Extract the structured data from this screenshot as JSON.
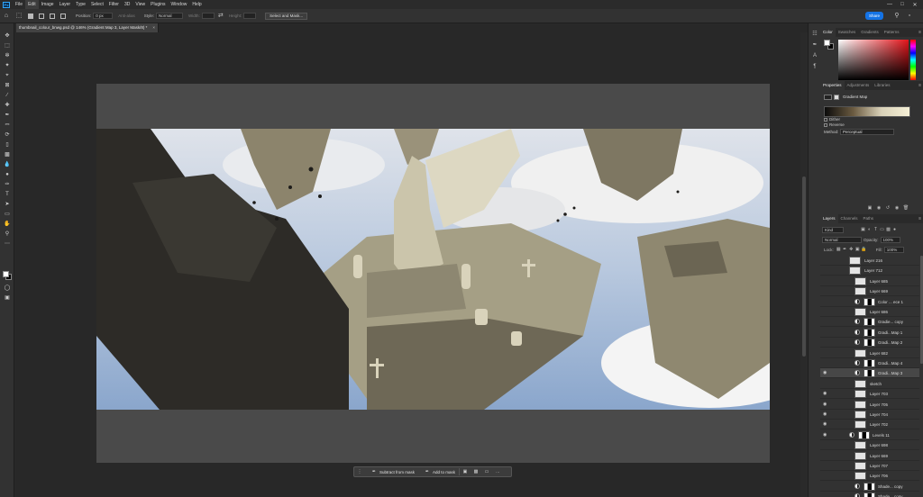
{
  "menu": [
    "File",
    "Edit",
    "Image",
    "Layer",
    "Type",
    "Select",
    "Filter",
    "3D",
    "View",
    "Plugins",
    "Window",
    "Help"
  ],
  "app_logo": "Ps",
  "options": {
    "position_label": "Position:",
    "position_value": "0 px",
    "antialias_label": "Anti-alias",
    "style_label": "Style:",
    "style_value": "Normal",
    "width_label": "Width:",
    "height_label": "Height:",
    "select_mask_button": "Select and Mask...",
    "share_button": "Share"
  },
  "document_tab": {
    "title": "thumbnail_colour_bnwg.psd @ 146% (Gradient Map 3, Layer Mask/8) *",
    "close": "×"
  },
  "contextual_taskbar": {
    "subtract_label": "Subtract from mask",
    "add_label": "Add to mask",
    "more": "···"
  },
  "color_panel": {
    "tabs": [
      "Color",
      "Swatches",
      "Gradients",
      "Patterns"
    ],
    "active_tab": "Color",
    "foreground": "#ffffff",
    "background": "#000000",
    "hue_color": "#e3141a"
  },
  "properties_panel": {
    "tabs": [
      "Properties",
      "Adjustments",
      "Libraries"
    ],
    "active_tab": "Properties",
    "title": "Gradient Map",
    "dither_label": "Dither",
    "reverse_label": "Reverse",
    "method_label": "Method:",
    "method_value": "Perceptual"
  },
  "layers_panel": {
    "tabs": [
      "Layers",
      "Channels",
      "Paths"
    ],
    "active_tab": "Layers",
    "filter_value": "Kind",
    "blend_mode": "Normal",
    "opacity_label": "Opacity:",
    "opacity_value": "100%",
    "lock_label": "Lock:",
    "fill_label": "Fill:",
    "fill_value": "100%",
    "layers": [
      {
        "name": "Layer 216",
        "visible": false,
        "type": "pixel",
        "indent": 1
      },
      {
        "name": "Layer 712",
        "visible": false,
        "type": "pixel",
        "indent": 1
      },
      {
        "name": "Layer 685",
        "visible": false,
        "type": "pixel",
        "indent": 2
      },
      {
        "name": "Layer 669",
        "visible": false,
        "type": "pixel",
        "indent": 2
      },
      {
        "name": "Color ... ece 1",
        "visible": false,
        "type": "adjustment",
        "indent": 2
      },
      {
        "name": "Layer 686",
        "visible": false,
        "type": "pixel",
        "indent": 2
      },
      {
        "name": "Gradie... copy",
        "visible": false,
        "type": "adjustment",
        "indent": 2
      },
      {
        "name": "Gradi...Map 1",
        "visible": false,
        "type": "adjustment",
        "indent": 2
      },
      {
        "name": "Gradi...Map 2",
        "visible": false,
        "type": "adjustment",
        "indent": 2
      },
      {
        "name": "Layer 682",
        "visible": false,
        "type": "pixel",
        "indent": 2
      },
      {
        "name": "Gradi...Map 4",
        "visible": false,
        "type": "adjustment",
        "indent": 2
      },
      {
        "name": "Gradi...Map 3",
        "visible": true,
        "type": "adjustment",
        "indent": 2,
        "selected": true
      },
      {
        "name": "sketch",
        "visible": false,
        "type": "pixel",
        "indent": 2
      },
      {
        "name": "Layer 703",
        "visible": true,
        "type": "pixel",
        "indent": 2
      },
      {
        "name": "Layer 705",
        "visible": true,
        "type": "pixel",
        "indent": 2
      },
      {
        "name": "Layer 704",
        "visible": true,
        "type": "pixel",
        "indent": 2
      },
      {
        "name": "Layer 702",
        "visible": true,
        "type": "pixel",
        "indent": 2
      },
      {
        "name": "Levels 11",
        "visible": true,
        "type": "adjustment",
        "indent": 1
      },
      {
        "name": "Layer 698",
        "visible": false,
        "type": "pixel",
        "indent": 2
      },
      {
        "name": "Layer 669",
        "visible": false,
        "type": "pixel",
        "indent": 2
      },
      {
        "name": "Layer 707",
        "visible": false,
        "type": "pixel",
        "indent": 2
      },
      {
        "name": "Layer 706",
        "visible": false,
        "type": "pixel",
        "indent": 2
      },
      {
        "name": "Shade... copy",
        "visible": false,
        "type": "adjustment",
        "indent": 2
      },
      {
        "name": "Shade... copy",
        "visible": false,
        "type": "adjustment",
        "indent": 2
      }
    ]
  }
}
